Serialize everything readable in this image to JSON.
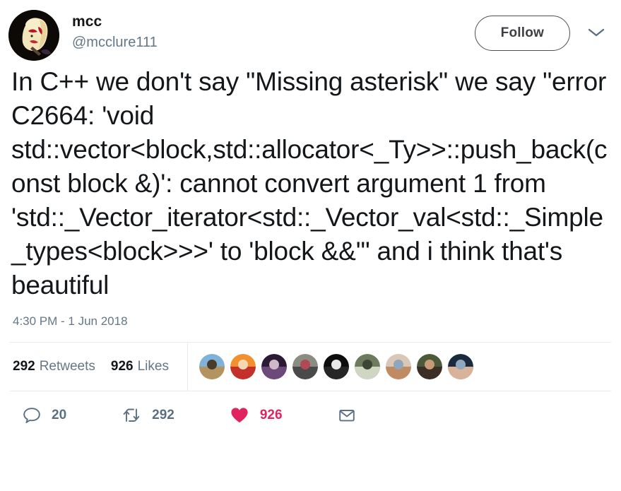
{
  "tweet": {
    "author": {
      "display_name": "mcc",
      "handle": "@mcclure111",
      "avatar_name": "author-avatar"
    },
    "follow_label": "Follow",
    "caret_icon": "chevron-down-icon",
    "text": "In C++ we don't say \"Missing asterisk\" we say \"error C2664: 'void std::vector<block,std::allocator<_Ty>>::push_back(const block &)': cannot convert argument 1 from 'std::_Vector_iterator<std::_Vector_val<std::_Simple_types<block>>>' to 'block &&'\" and i think that's beautiful",
    "timestamp": "4:30 PM - 1 Jun 2018",
    "stats": {
      "retweets_count": "292",
      "retweets_label": "Retweets",
      "likes_count": "926",
      "likes_label": "Likes"
    },
    "facepile": [
      {
        "name": "liker-avatar-1",
        "colors": [
          "#7fb2d8",
          "#b3935f",
          "#4a3c2a"
        ]
      },
      {
        "name": "liker-avatar-2",
        "colors": [
          "#f0902f",
          "#c4302b",
          "#f6d9b0"
        ]
      },
      {
        "name": "liker-avatar-3",
        "colors": [
          "#2b1a33",
          "#6b4a7a",
          "#d0b8c8"
        ]
      },
      {
        "name": "liker-avatar-4",
        "colors": [
          "#8b8d84",
          "#4a4a48",
          "#b04a55"
        ]
      },
      {
        "name": "liker-avatar-5",
        "colors": [
          "#0d0d0d",
          "#262626",
          "#e8e8e8"
        ]
      },
      {
        "name": "liker-avatar-6",
        "colors": [
          "#6d7a5c",
          "#cfd6c2",
          "#3d4636"
        ]
      },
      {
        "name": "liker-avatar-7",
        "colors": [
          "#d8c8b5",
          "#c08b63",
          "#8fa6bc"
        ]
      },
      {
        "name": "liker-avatar-8",
        "colors": [
          "#4c5a3a",
          "#3a2e26",
          "#c79a78"
        ]
      },
      {
        "name": "liker-avatar-9",
        "colors": [
          "#1b2a3d",
          "#d8b39a",
          "#8fa8c0"
        ]
      }
    ],
    "actions": {
      "reply": {
        "icon": "reply-icon",
        "count": "20"
      },
      "retweet": {
        "icon": "retweet-icon",
        "count": "292"
      },
      "like": {
        "icon": "heart-icon",
        "count": "926"
      },
      "dm": {
        "icon": "envelope-icon"
      }
    }
  },
  "colors": {
    "text": "#14171a",
    "muted": "#657786",
    "icon": "#5b7083",
    "like": "#e0245e",
    "divider": "#e6ecf0"
  }
}
